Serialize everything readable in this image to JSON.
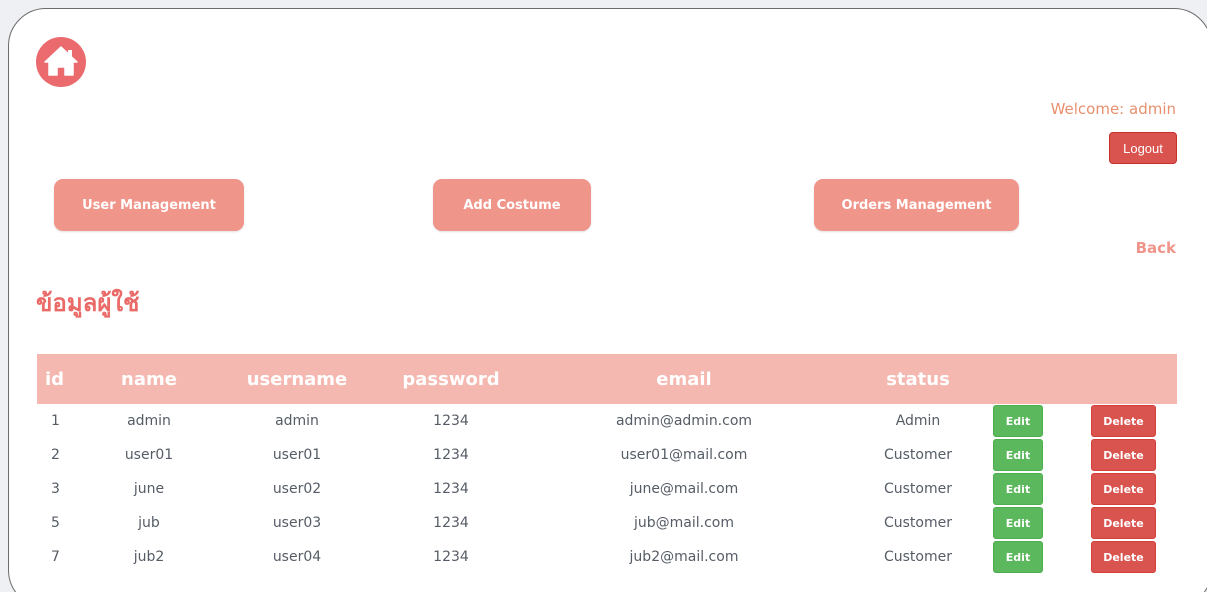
{
  "header": {
    "home_icon": "home-icon",
    "welcome_text": "Welcome: admin",
    "logout_label": "Logout"
  },
  "nav": {
    "user_management": "User Management",
    "add_costume": "Add Costume",
    "orders_management": "Orders Management",
    "back": "Back"
  },
  "page": {
    "title": "ข้อมูลผู้ใช้"
  },
  "table": {
    "headers": [
      "id",
      "name",
      "username",
      "password",
      "email",
      "status",
      "",
      ""
    ],
    "rows": [
      {
        "id": "1",
        "name": "admin",
        "username": "admin",
        "password": "1234",
        "email": "admin@admin.com",
        "status": "Admin",
        "edit": "Edit",
        "delete": "Delete"
      },
      {
        "id": "2",
        "name": "user01",
        "username": "user01",
        "password": "1234",
        "email": "user01@mail.com",
        "status": "Customer",
        "edit": "Edit",
        "delete": "Delete"
      },
      {
        "id": "3",
        "name": "june",
        "username": "user02",
        "password": "1234",
        "email": "june@mail.com",
        "status": "Customer",
        "edit": "Edit",
        "delete": "Delete"
      },
      {
        "id": "5",
        "name": "jub",
        "username": "user03",
        "password": "1234",
        "email": "jub@mail.com",
        "status": "Customer",
        "edit": "Edit",
        "delete": "Delete"
      },
      {
        "id": "7",
        "name": "jub2",
        "username": "user04",
        "password": "1234",
        "email": "jub2@mail.com",
        "status": "Customer",
        "edit": "Edit",
        "delete": "Delete"
      }
    ]
  },
  "colors": {
    "accent": "#f0958a",
    "title": "#ea6a68",
    "header_row": "#f5b8b0",
    "welcome": "#e8906e",
    "danger": "#d9534f",
    "success": "#5cb85c"
  }
}
